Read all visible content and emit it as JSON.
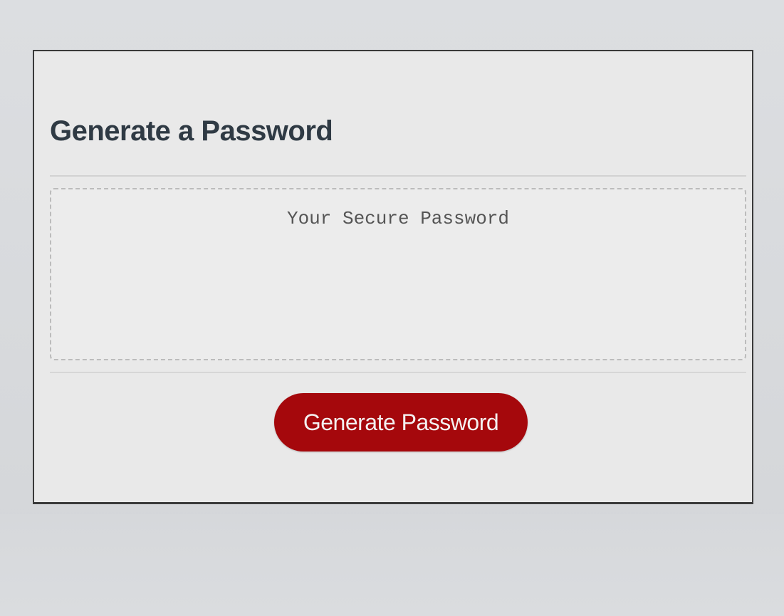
{
  "card": {
    "title": "Generate a Password"
  },
  "password": {
    "placeholder": "Your Secure Password",
    "value": ""
  },
  "actions": {
    "generate_label": "Generate Password"
  },
  "colors": {
    "accent": "#a5080c",
    "title": "#2f3a44",
    "card_background": "#e9e9e9"
  }
}
